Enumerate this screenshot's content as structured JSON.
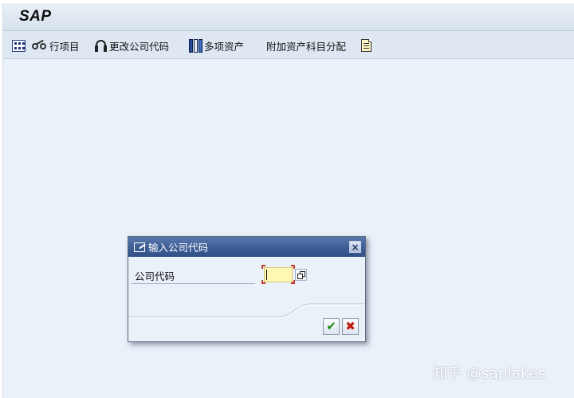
{
  "app": {
    "logo": "SAP"
  },
  "toolbar": {
    "items": [
      {
        "label": "",
        "icon": "grid-icon"
      },
      {
        "label": "行项目",
        "icon": "glasses-icon"
      },
      {
        "label": "更改公司代码",
        "icon": "headset-icon"
      },
      {
        "label": "多项资产",
        "icon": "books-icon"
      },
      {
        "label": "附加资产科目分配",
        "icon": ""
      },
      {
        "label": "",
        "icon": "document-icon"
      }
    ]
  },
  "dialog": {
    "title": "输入公司代码",
    "title_icon": "edit-icon",
    "close_icon": "close-icon",
    "field_label": "公司代码",
    "field_value": "",
    "f4_icon": "f4-help-icon",
    "ok_icon": "check-icon",
    "cancel_icon": "cancel-icon",
    "ok_glyph": "✔",
    "cancel_glyph": "✖",
    "close_glyph": "×"
  },
  "watermark": "知乎 @saplakes",
  "colors": {
    "background": "#eaf1f9",
    "toolbar": "#dfe8f2",
    "dialog_title": "#3e5e96",
    "input_required": "#fff7b3",
    "ok_green": "#1d8a12",
    "cancel_red": "#c21a0e"
  }
}
